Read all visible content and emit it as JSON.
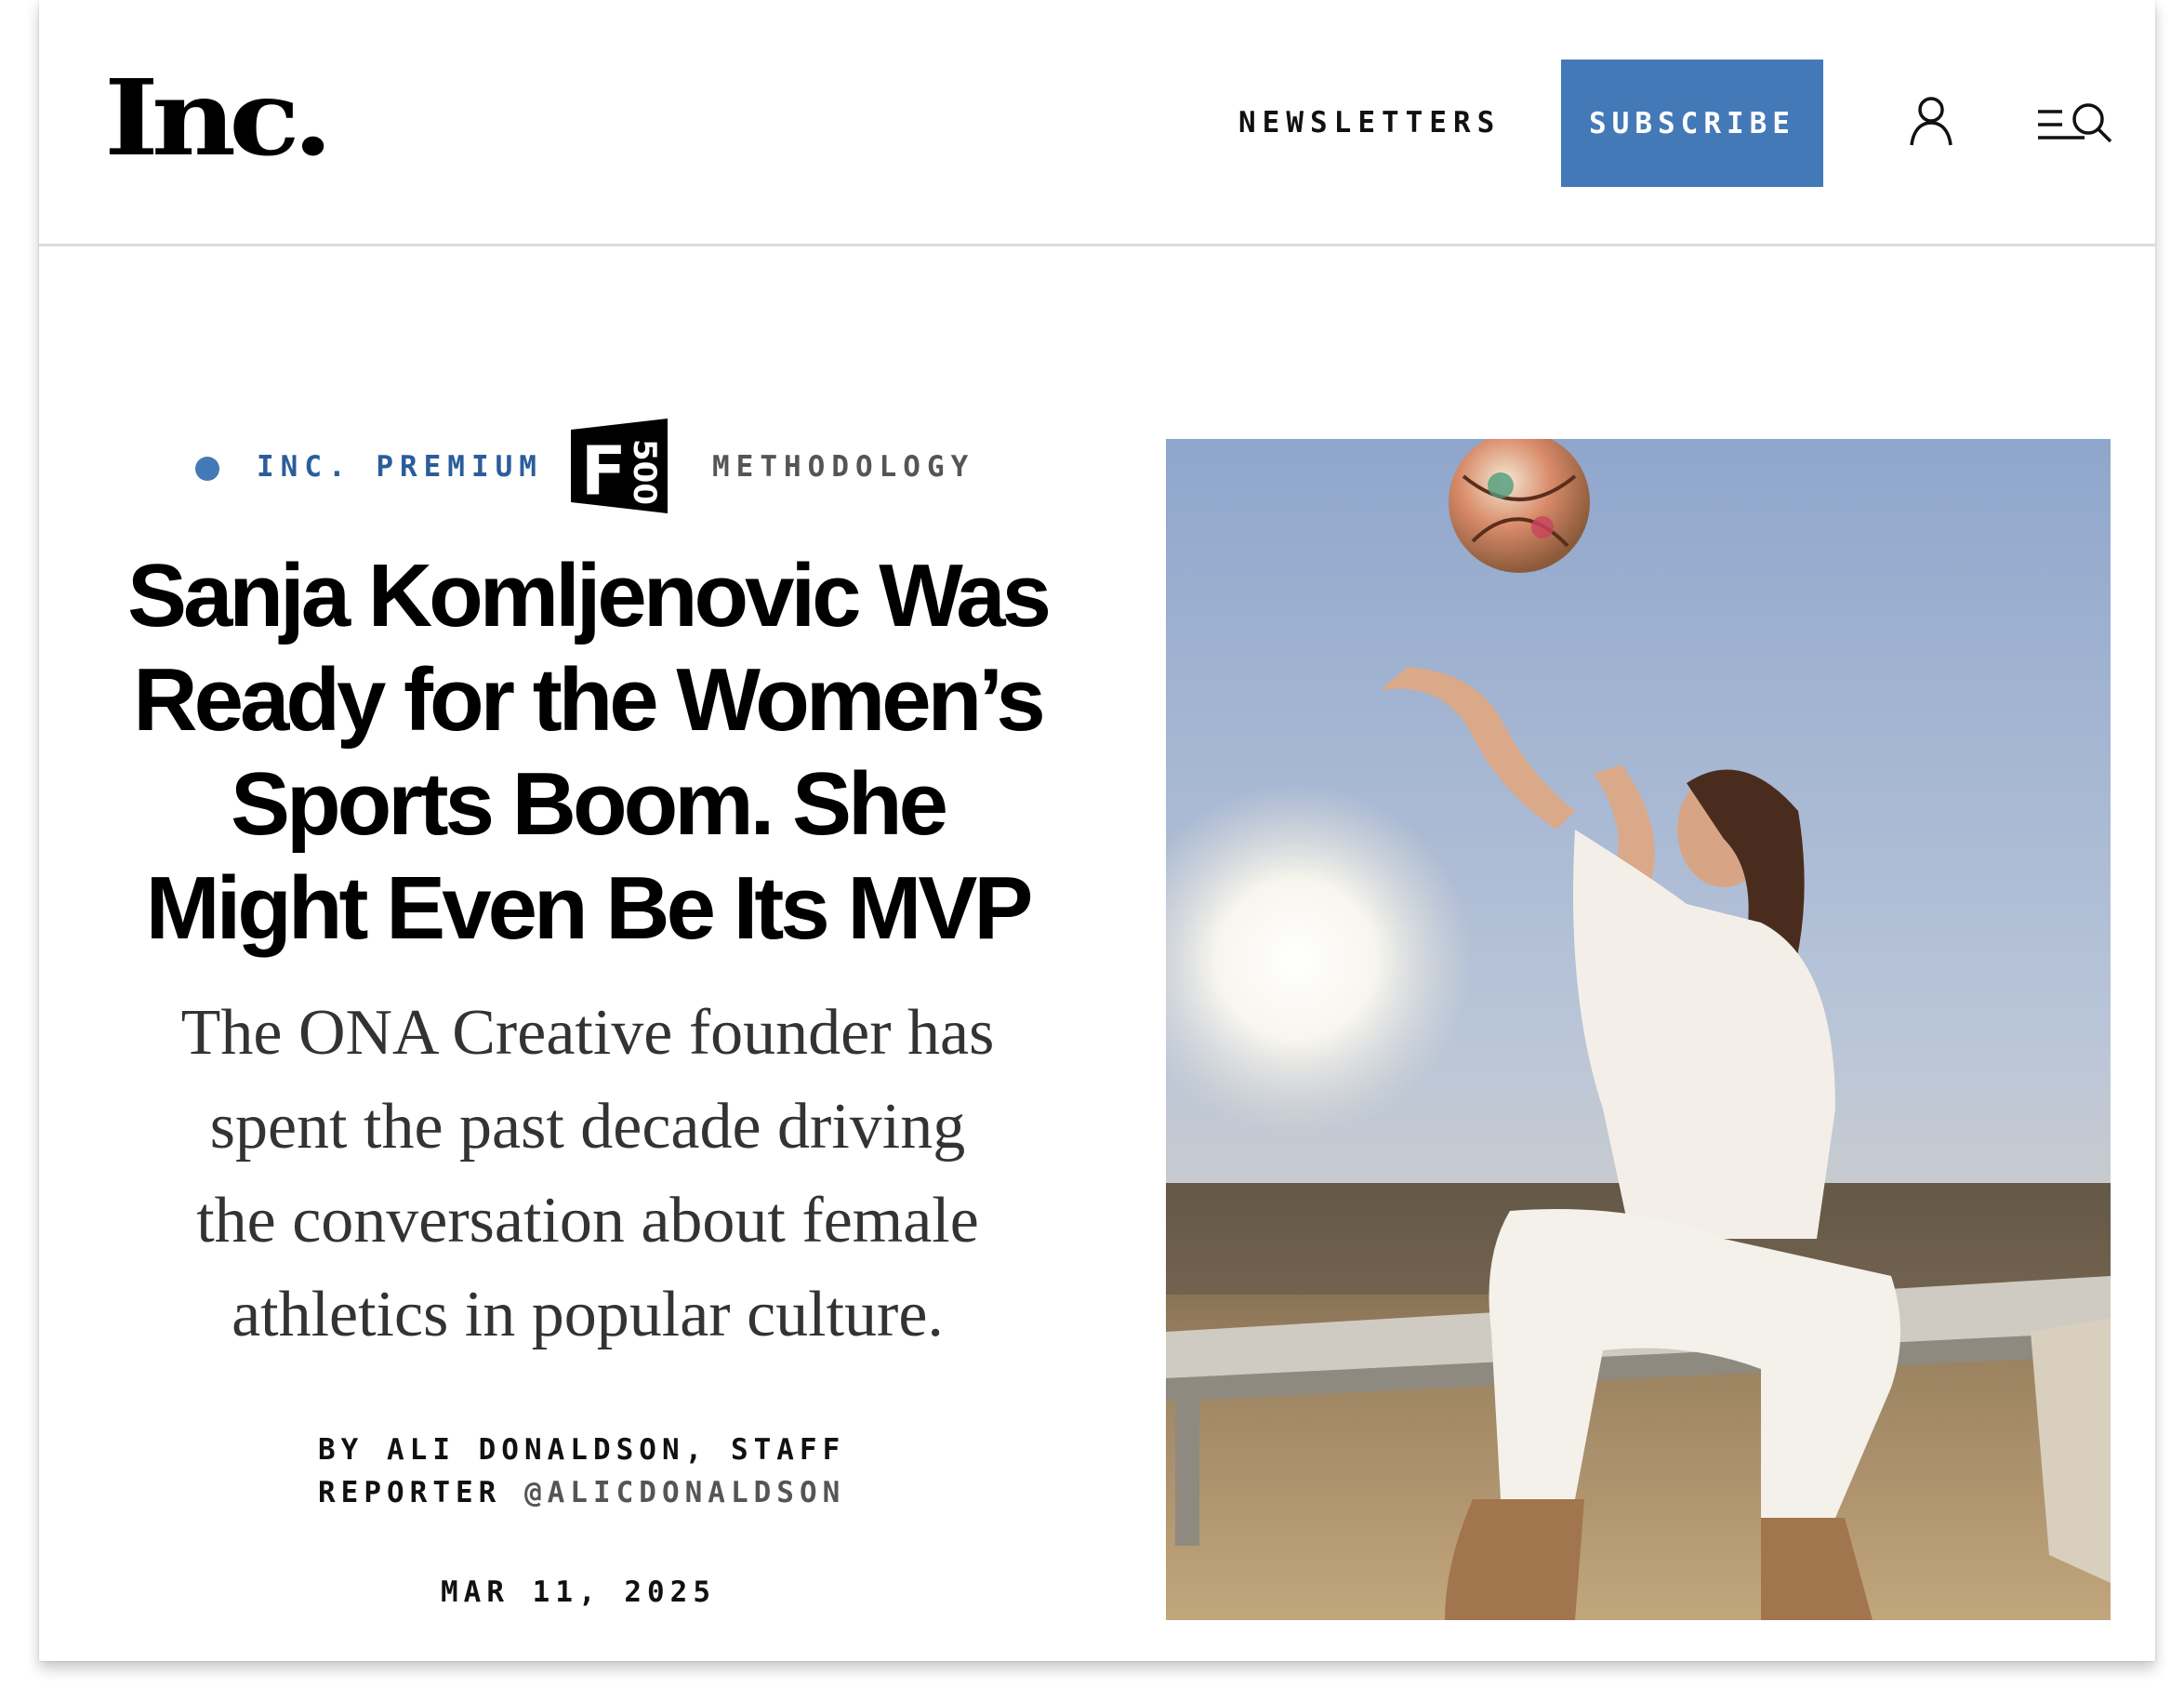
{
  "header": {
    "logo": "Inc.",
    "newsletters_label": "NEWSLETTERS",
    "subscribe_label": "SUBSCRIBE",
    "user_icon": "user-icon",
    "menu_search_icon": "menu-search-icon"
  },
  "article": {
    "kicker": {
      "premium_label": "INC. PREMIUM",
      "badge_text": "500",
      "badge_letter": "F",
      "methodology_label": "METHODOLOGY"
    },
    "headline_lines": [
      "Sanja Komljenovic Was",
      "Ready for the Women’s",
      "Sports Boom. She",
      "Might Even Be Its MVP"
    ],
    "dek_lines": [
      "The ONA Creative founder has",
      "spent the past decade driving",
      "the conversation about female",
      "athletics in popular culture."
    ],
    "byline_prefix": "BY ALI DONALDSON, STAFF",
    "byline_line2": "REPORTER",
    "byline_handle": "@ALICDONALDSON",
    "date": "MAR 11, 2025"
  },
  "colors": {
    "accent_blue": "#4479b8",
    "premium_blue": "#2b5d9c",
    "text": "#000000"
  }
}
